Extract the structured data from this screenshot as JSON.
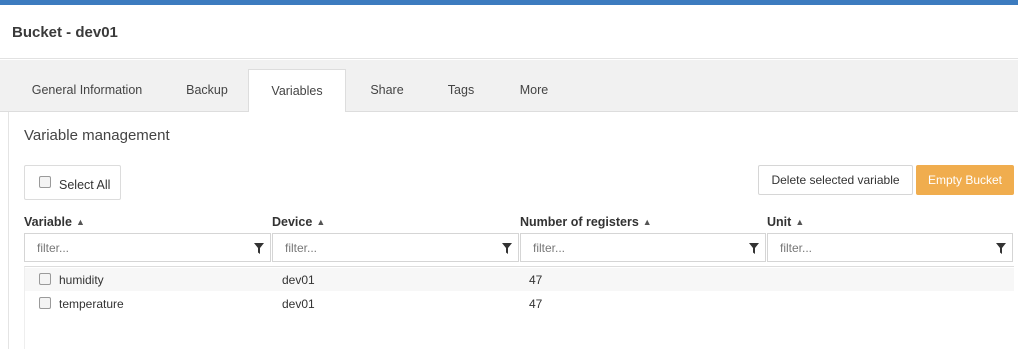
{
  "header": {
    "title": "Bucket - dev01"
  },
  "tabs": [
    {
      "label": "General Information"
    },
    {
      "label": "Backup"
    },
    {
      "label": "Variables"
    },
    {
      "label": "Share"
    },
    {
      "label": "Tags"
    },
    {
      "label": "More"
    }
  ],
  "active_tab": "Variables",
  "panel": {
    "title": "Variable management"
  },
  "toolbar": {
    "select_all_label": "Select All",
    "delete_label": "Delete selected variable",
    "empty_label": "Empty Bucket",
    "empty_color": "#f0ad4e"
  },
  "table": {
    "columns": [
      {
        "label": "Variable",
        "filter_placeholder": "filter..."
      },
      {
        "label": "Device",
        "filter_placeholder": "filter..."
      },
      {
        "label": "Number of registers",
        "filter_placeholder": "filter..."
      },
      {
        "label": "Unit",
        "filter_placeholder": "filter..."
      }
    ],
    "rows": [
      {
        "variable": "humidity",
        "device": "dev01",
        "registers": "47",
        "unit": ""
      },
      {
        "variable": "temperature",
        "device": "dev01",
        "registers": "47",
        "unit": ""
      }
    ]
  },
  "icons": {
    "sort": "sort-icon",
    "filter": "filter-icon",
    "checkbox": "checkbox-icon"
  },
  "colors": {
    "header_stripe": "#3c7bbf"
  }
}
